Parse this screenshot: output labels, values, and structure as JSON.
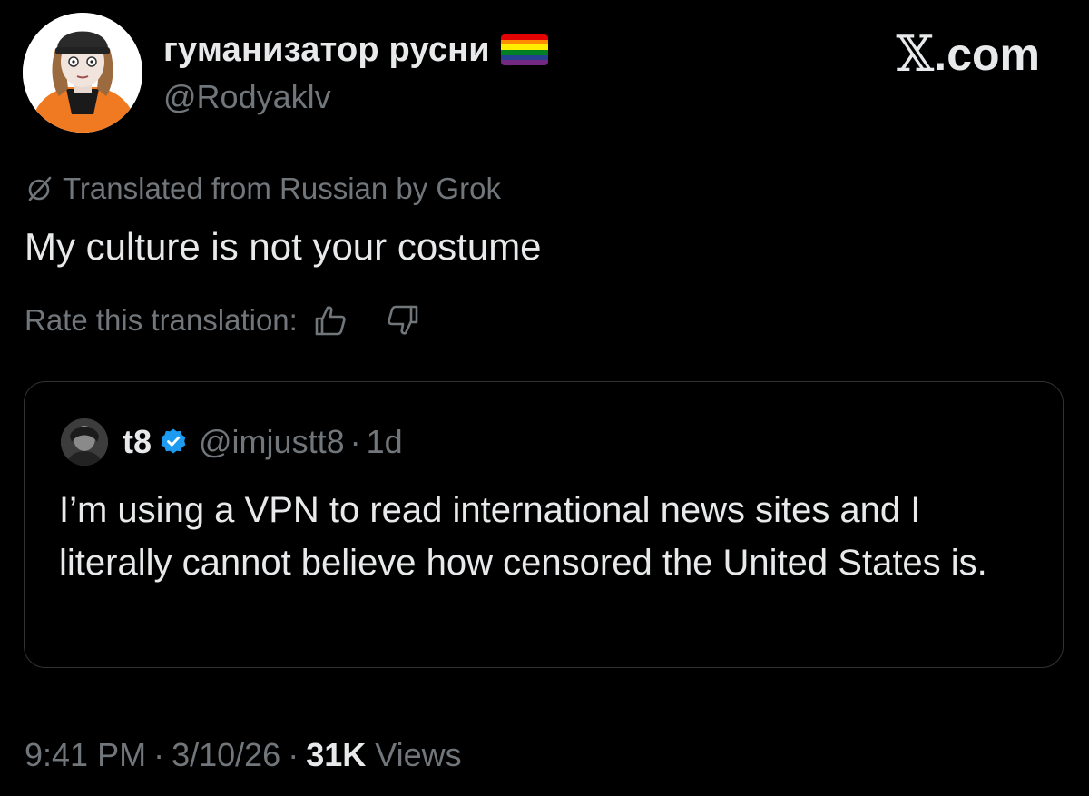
{
  "author": {
    "display_name": "гуманизатор русни",
    "handle": "@Rodyaklv",
    "flag_icon": "rainbow-flag-icon",
    "flag_colors": [
      "#e40303",
      "#ff8c00",
      "#ffed00",
      "#008026",
      "#24408e",
      "#732982"
    ]
  },
  "brand": {
    "x_mark": "𝕏",
    "domain": ".com"
  },
  "translation": {
    "note": "Translated from Russian by Grok",
    "icon": "grok-icon"
  },
  "tweet": {
    "text": "My culture is not your costume"
  },
  "rate": {
    "label": "Rate this translation:",
    "up_icon": "thumbs-up-icon",
    "down_icon": "thumbs-down-icon"
  },
  "quote": {
    "name": "t8",
    "handle": "@imjustt8",
    "separator": "·",
    "time": "1d",
    "text": "I’m using a VPN to read international news sites and I literally cannot believe how censored the United States is.",
    "verified_color": "#1d9bf0"
  },
  "meta": {
    "time": "9:41 PM",
    "date": "3/10/26",
    "separator": "·",
    "views_count": "31K",
    "views_label": "Views"
  },
  "colors": {
    "background": "#000000",
    "primary_text": "#e7e9ea",
    "secondary_text": "#71767b",
    "border": "#2f3336",
    "avatar_hood": "#f07a22"
  }
}
